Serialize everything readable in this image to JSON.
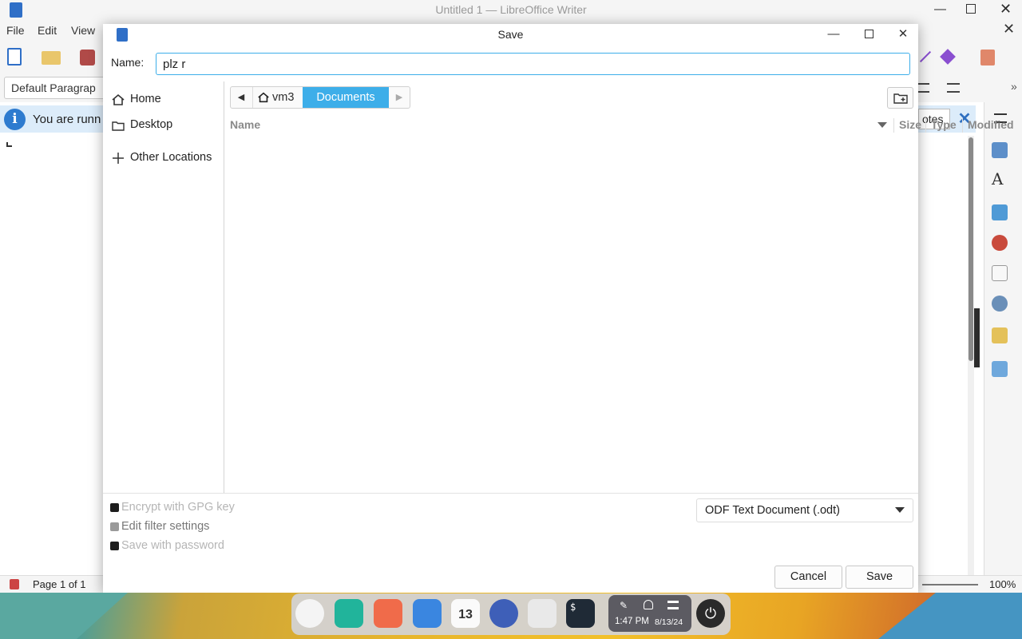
{
  "writer": {
    "title": "Untitled 1 — LibreOffice Writer",
    "menu": [
      "File",
      "Edit",
      "View"
    ],
    "paragraph_style": "Default Paragrap",
    "infobar_text": "You are runn",
    "notes_label": "otes",
    "status_page": "Page 1 of 1",
    "zoom": "100%"
  },
  "dialog": {
    "title": "Save",
    "name_label": "Name:",
    "name_value": "plz r",
    "places": [
      {
        "label": "Home",
        "icon": "home-icon"
      },
      {
        "label": "Desktop",
        "icon": "folder-icon"
      },
      {
        "label": "Other Locations",
        "icon": "plus-icon"
      }
    ],
    "path": [
      "vm3",
      "Documents"
    ],
    "columns": {
      "name": "Name",
      "size": "Size",
      "type": "Type",
      "modified": "Modified"
    },
    "options": {
      "gpg": "Encrypt with GPG key",
      "filter": "Edit filter settings",
      "password": "Save with password"
    },
    "file_type": "ODF Text Document (.odt)",
    "cancel_label": "Cancel",
    "save_label": "Save"
  },
  "taskbar": {
    "calendar_day": "13",
    "time": "1:47 PM",
    "date": "8/13/24"
  }
}
